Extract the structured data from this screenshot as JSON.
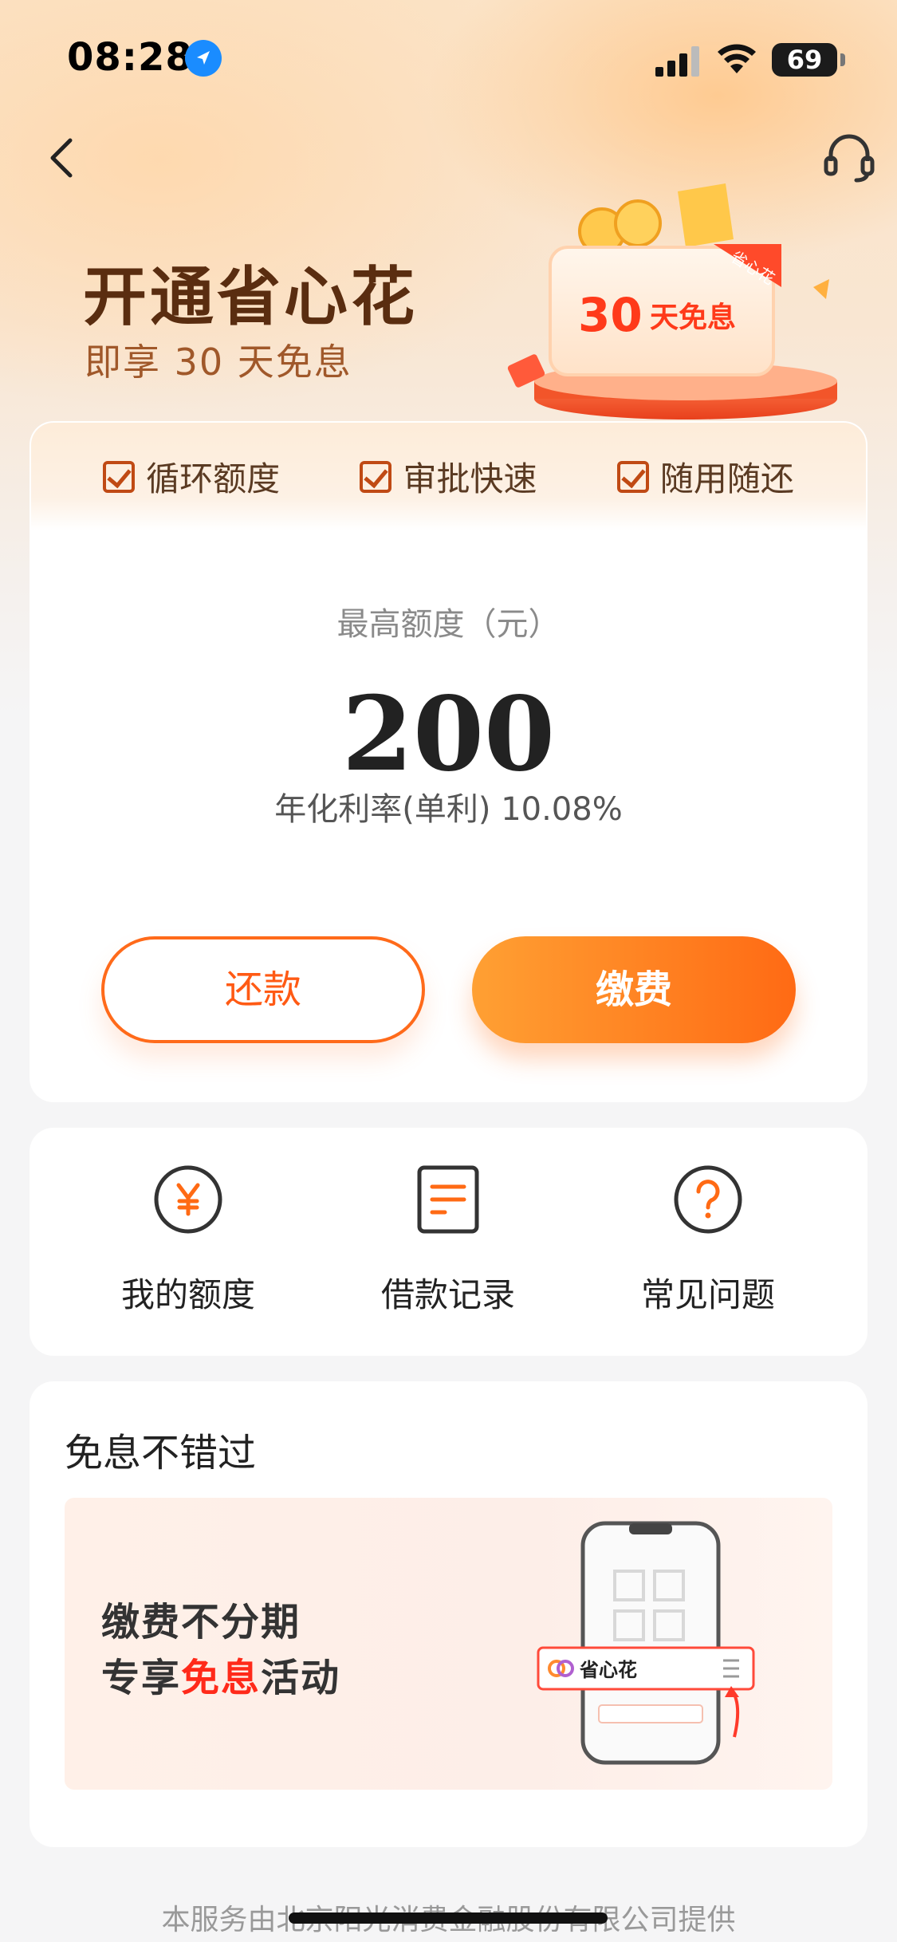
{
  "status_bar": {
    "time": "08:28",
    "battery": "69"
  },
  "hero": {
    "title": "开通省心花",
    "subtitle": "即享 30 天免息",
    "ticket_days": "30",
    "ticket_text": "天免息",
    "ticket_tag": "省心花"
  },
  "features": [
    {
      "label": "循环额度"
    },
    {
      "label": "审批快速"
    },
    {
      "label": "随用随还"
    }
  ],
  "limit": {
    "label": "最高额度（元）",
    "value": "200",
    "rate": "年化利率(单利) 10.08%"
  },
  "buttons": {
    "repay": "还款",
    "pay": "缴费"
  },
  "quick_links": [
    {
      "label": "我的额度",
      "icon": "yen-icon"
    },
    {
      "label": "借款记录",
      "icon": "document-icon"
    },
    {
      "label": "常见问题",
      "icon": "question-icon"
    }
  ],
  "promo": {
    "title": "免息不错过",
    "line1": "缴费不分期",
    "line2_prefix": "专享",
    "line2_highlight": "免息",
    "line2_suffix": "活动",
    "card_label": "省心花"
  },
  "footer": "本服务由北京阳光消费金融股份有限公司提供",
  "colors": {
    "accent": "#ff6a14",
    "highlight": "#ff2a1a",
    "title": "#5a2d10"
  }
}
